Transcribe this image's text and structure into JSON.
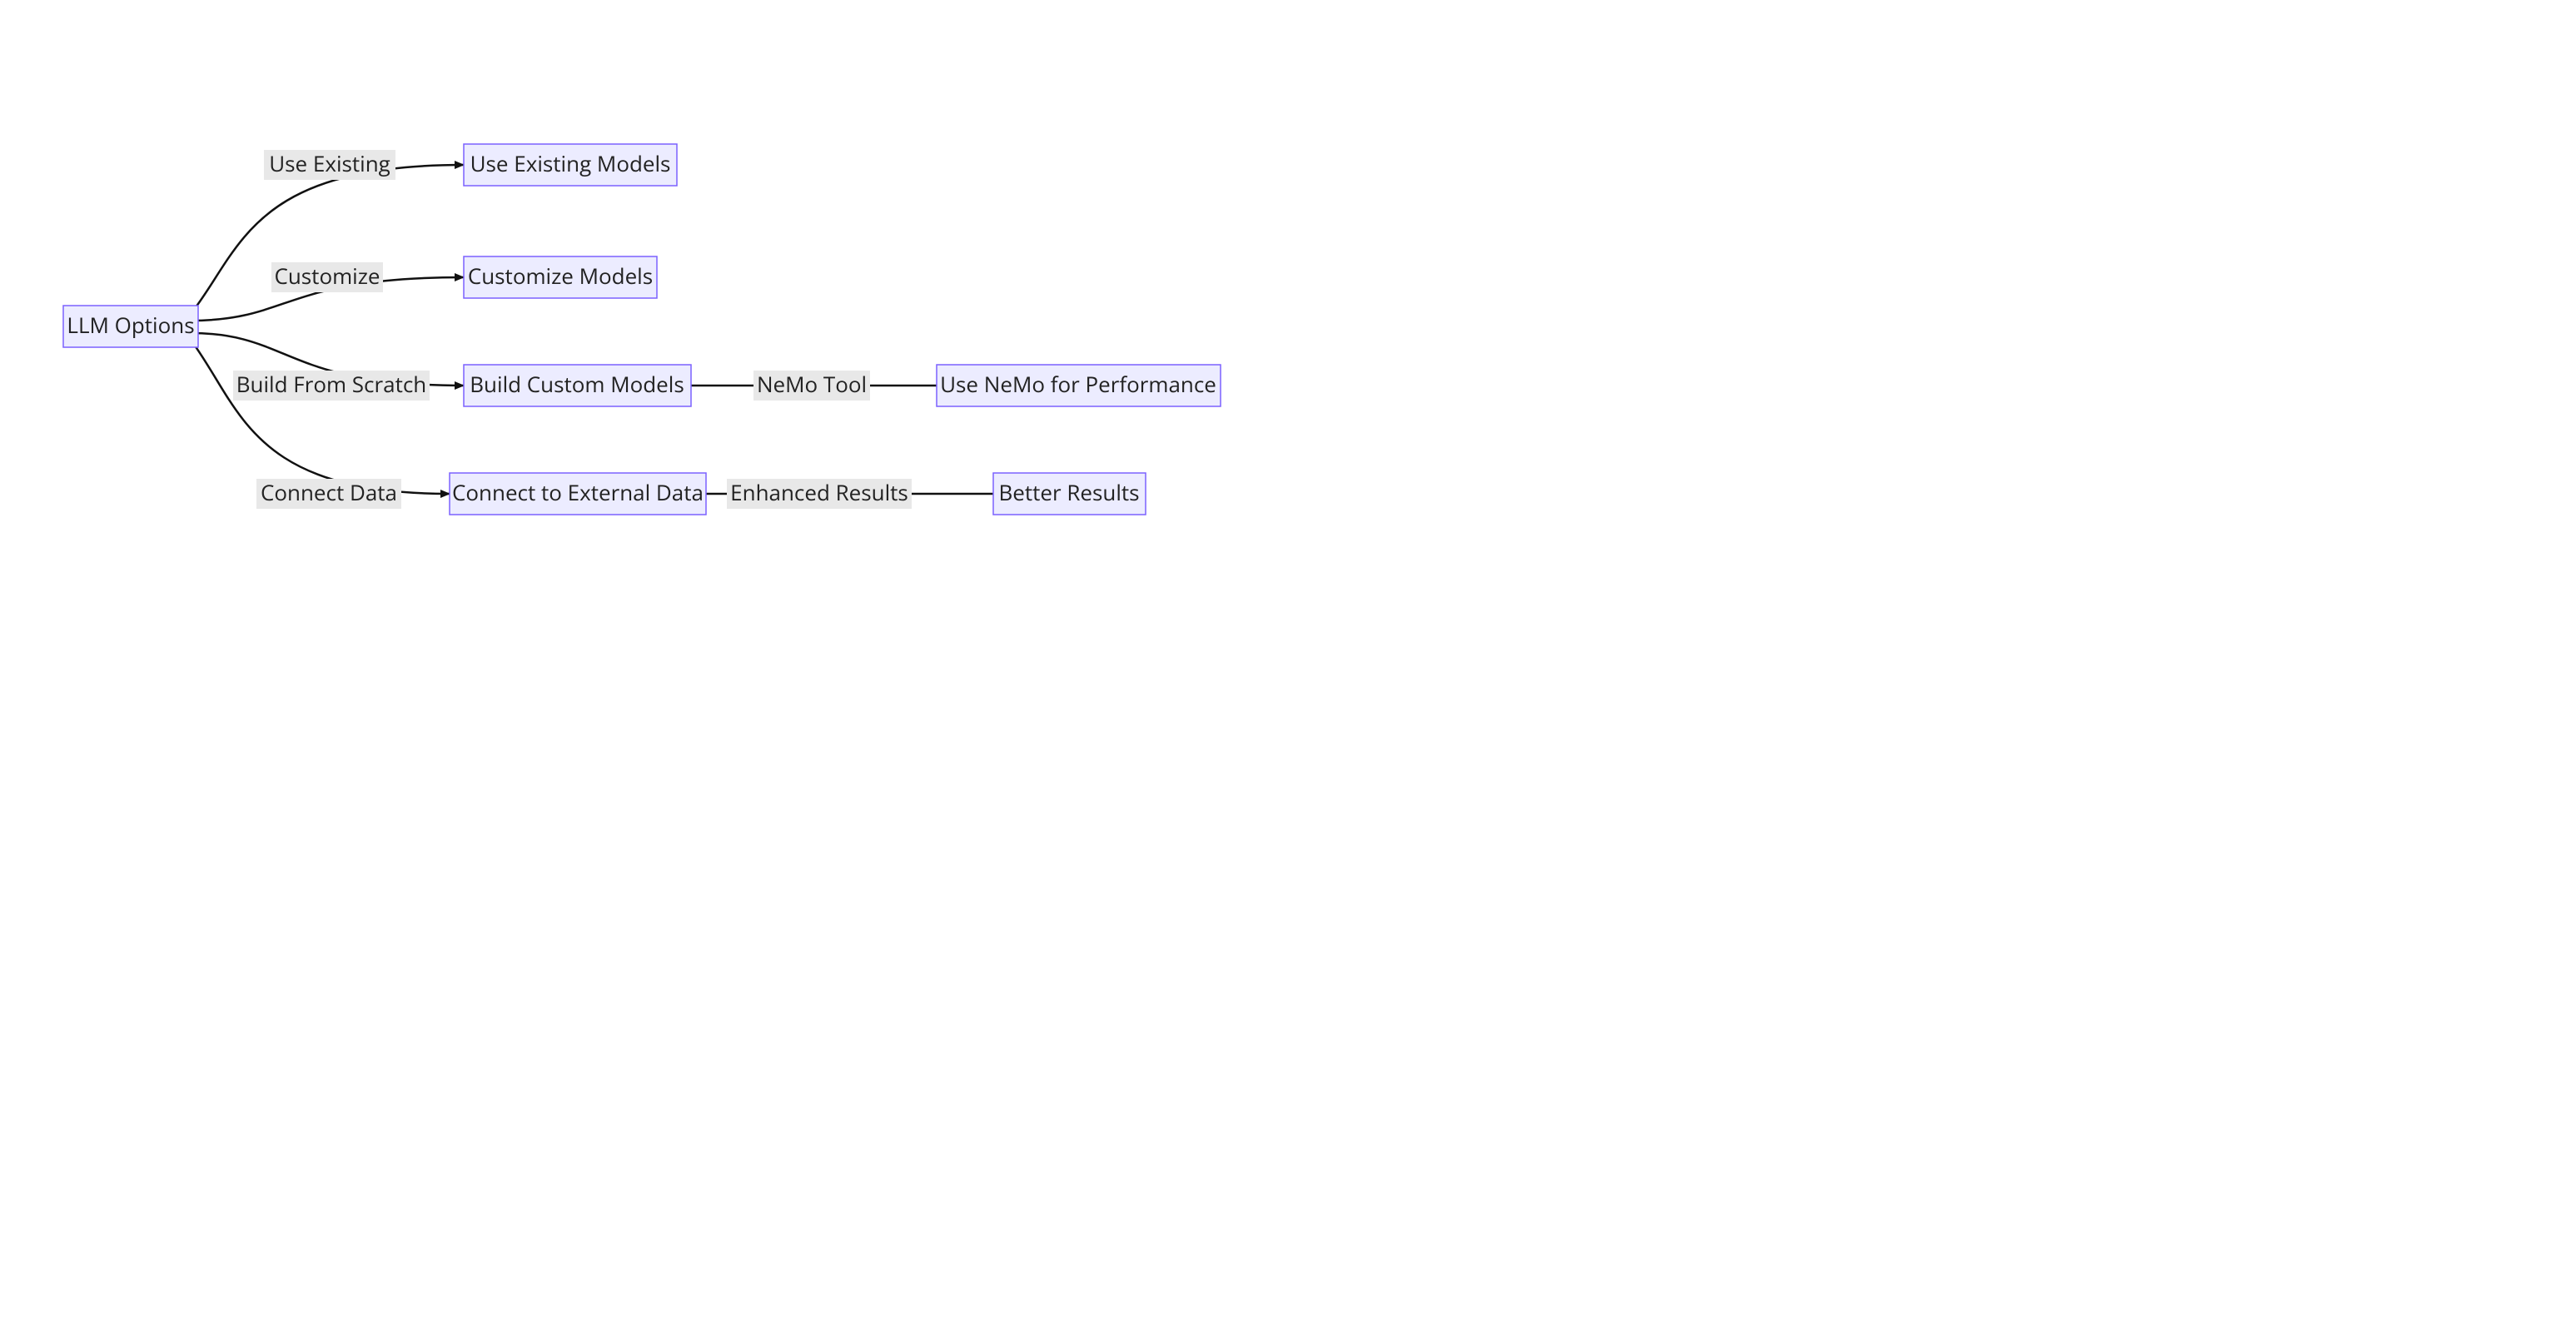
{
  "diagram": {
    "nodes": {
      "root": {
        "label": "LLM Options"
      },
      "useEx": {
        "label": "Use Existing Models"
      },
      "customize": {
        "label": "Customize Models"
      },
      "build": {
        "label": "Build Custom Models"
      },
      "nemo": {
        "label": "Use NeMo for Performance"
      },
      "connect": {
        "label": "Connect to External Data"
      },
      "better": {
        "label": "Better Results"
      }
    },
    "edges": {
      "e_useEx": {
        "label": "Use Existing"
      },
      "e_customize": {
        "label": "Customize"
      },
      "e_build": {
        "label": "Build From Scratch"
      },
      "e_nemo": {
        "label": "NeMo Tool"
      },
      "e_connect": {
        "label": "Connect Data"
      },
      "e_better": {
        "label": "Enhanced Results"
      }
    }
  }
}
